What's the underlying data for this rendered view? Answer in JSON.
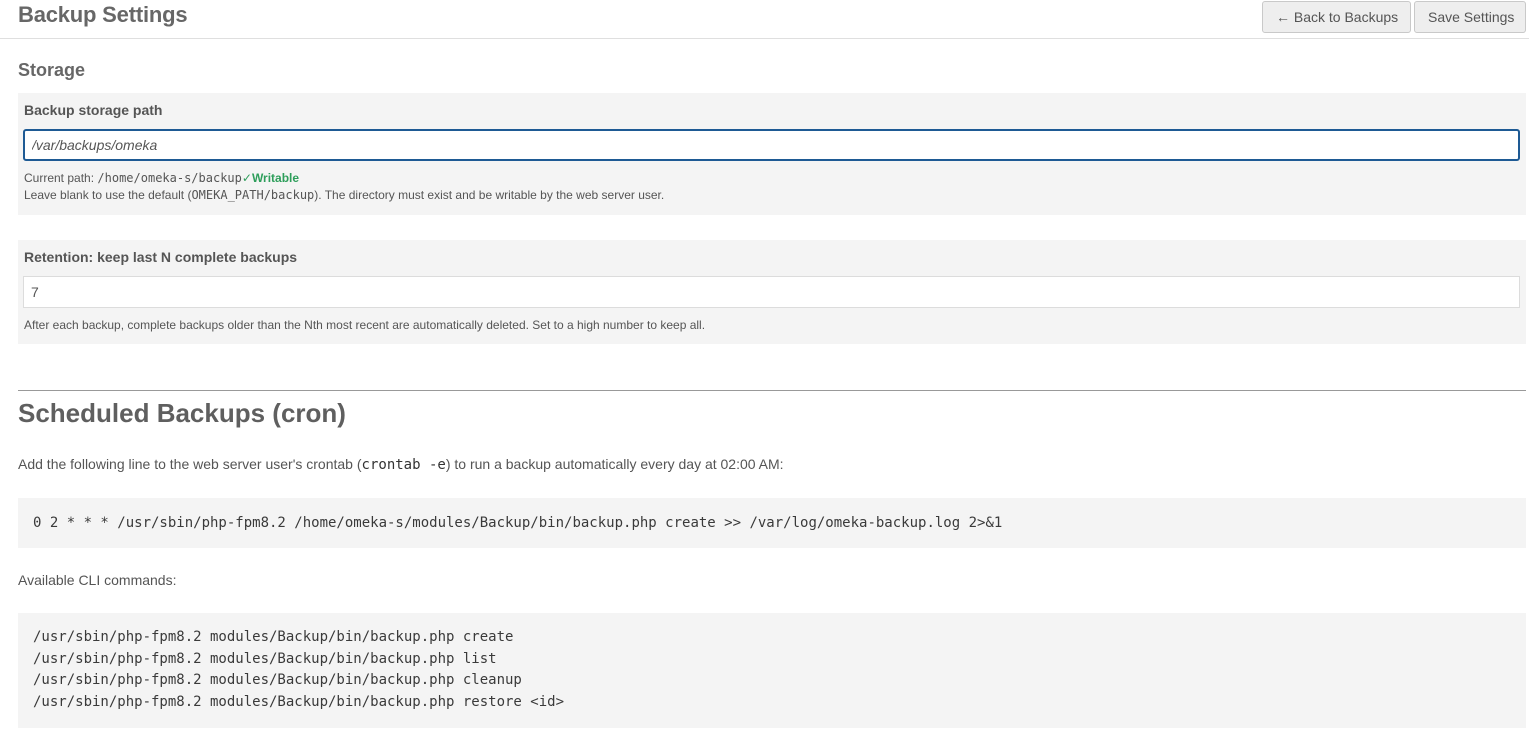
{
  "header": {
    "title": "Backup Settings",
    "back_label": "← Back to Backups",
    "save_label": "Save Settings"
  },
  "storage": {
    "heading": "Storage",
    "path_field": {
      "label": "Backup storage path",
      "value": "/var/backups/omeka",
      "current_path_prefix": "Current path:",
      "current_path": "/home/omeka-s/backup",
      "status": "✓Writable",
      "status_color": "#2e9e5b",
      "help_before": "Leave blank to use the default (",
      "help_code": "OMEKA_PATH/backup",
      "help_after": "). The directory must exist and be writable by the web server user."
    },
    "retention_field": {
      "label": "Retention: keep last N complete backups",
      "value": "7",
      "help": "After each backup, complete backups older than the Nth most recent are automatically deleted. Set to a high number to keep all."
    }
  },
  "cron": {
    "heading": "Scheduled Backups (cron)",
    "intro_before": "Add the following line to the web server user's crontab (",
    "intro_code": "crontab -e",
    "intro_after": ") to run a backup automatically every day at 02:00 AM:",
    "cron_line": "0 2 * * * /usr/sbin/php-fpm8.2 /home/omeka-s/modules/Backup/bin/backup.php create >> /var/log/omeka-backup.log 2>&1",
    "cli_heading": "Available CLI commands:",
    "cli_commands": [
      "/usr/sbin/php-fpm8.2 modules/Backup/bin/backup.php create",
      "/usr/sbin/php-fpm8.2 modules/Backup/bin/backup.php list",
      "/usr/sbin/php-fpm8.2 modules/Backup/bin/backup.php cleanup",
      "/usr/sbin/php-fpm8.2 modules/Backup/bin/backup.php restore <id>"
    ]
  },
  "colors": {
    "accent_border": "#1e5a94",
    "panel_bg": "#f4f4f4",
    "text": "#676767"
  }
}
